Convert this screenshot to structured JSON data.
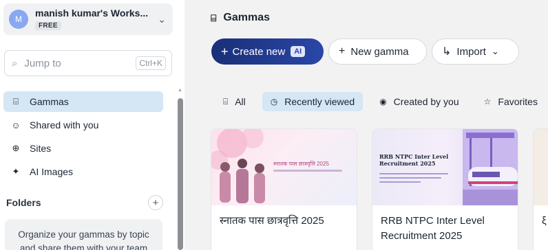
{
  "workspace": {
    "avatar": "M",
    "name": "manish kumar's Works...",
    "plan": "FREE",
    "chevron_icon": "chevron-down-icon"
  },
  "search": {
    "placeholder": "Jump to",
    "shortcut": "Ctrl+K",
    "icon": "search-icon"
  },
  "sidebar": {
    "items": [
      {
        "label": "Gammas",
        "icon": "gammas-icon",
        "active": true
      },
      {
        "label": "Shared with you",
        "icon": "people-icon",
        "active": false
      },
      {
        "label": "Sites",
        "icon": "globe-icon",
        "active": false
      },
      {
        "label": "AI Images",
        "icon": "sparkle-icon",
        "active": false
      }
    ],
    "folders_title": "Folders",
    "folders_hint": "Organize your gammas by topic and share them with your team"
  },
  "main": {
    "title": "Gammas",
    "buttons": {
      "create": "Create new",
      "ai_tag": "AI",
      "new_gamma": "New gamma",
      "import": "Import"
    },
    "filters": [
      {
        "label": "All",
        "icon": "gammas-icon",
        "active": false
      },
      {
        "label": "Recently viewed",
        "icon": "clock-icon",
        "active": true
      },
      {
        "label": "Created by you",
        "icon": "user-circle-icon",
        "active": false
      },
      {
        "label": "Favorites",
        "icon": "star-icon",
        "active": false
      }
    ],
    "cards": [
      {
        "title": "स्नातक पास छात्रवृत्ति 2025",
        "thumb_title": "स्नातक पास छात्रवृत्ति 2025"
      },
      {
        "title": "RRB NTPC Inter Level Recruitment 2025",
        "thumb_title": "RRB NTPC Inter Level Recruitment 2025"
      },
      {
        "title": "ξ"
      }
    ]
  },
  "colors": {
    "accent": "#1a2f78",
    "active_bg": "#d5e6f4",
    "avatar": "#8aa8f0"
  }
}
